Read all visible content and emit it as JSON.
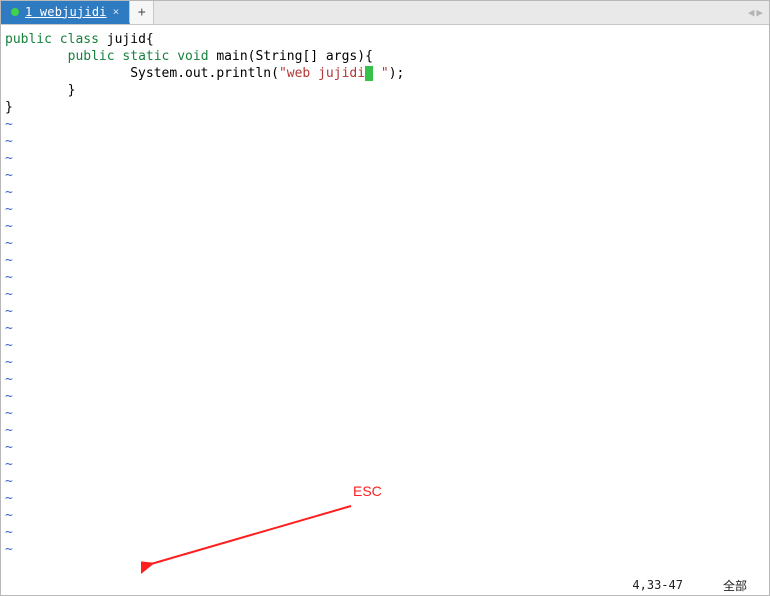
{
  "tabbar": {
    "active_tab_label": "1 webjujidi",
    "close_glyph": "×",
    "newtab_glyph": "+",
    "nav_left": "◀",
    "nav_right": "▶"
  },
  "code": {
    "l1_kw1": "public",
    "l1_kw2": "class",
    "l1_rest": " jujid{",
    "blank": "",
    "l3_indent": "        ",
    "l3_kw1": "public",
    "l3_kw2": "static",
    "l3_kw3": "void",
    "l3_rest": " main(String[] args){",
    "l4_indent": "                ",
    "l4_call": "System.out.println(",
    "l4_str_open": "\"web jujidi",
    "l4_str_close": " \"",
    "l4_tail": ");",
    "l5_indent": "        ",
    "l5_brace": "}",
    "l6_brace": "}",
    "tilde": "~"
  },
  "annotation": {
    "label": "ESC"
  },
  "status": {
    "pos": "4,33-47",
    "scope": "全部"
  }
}
